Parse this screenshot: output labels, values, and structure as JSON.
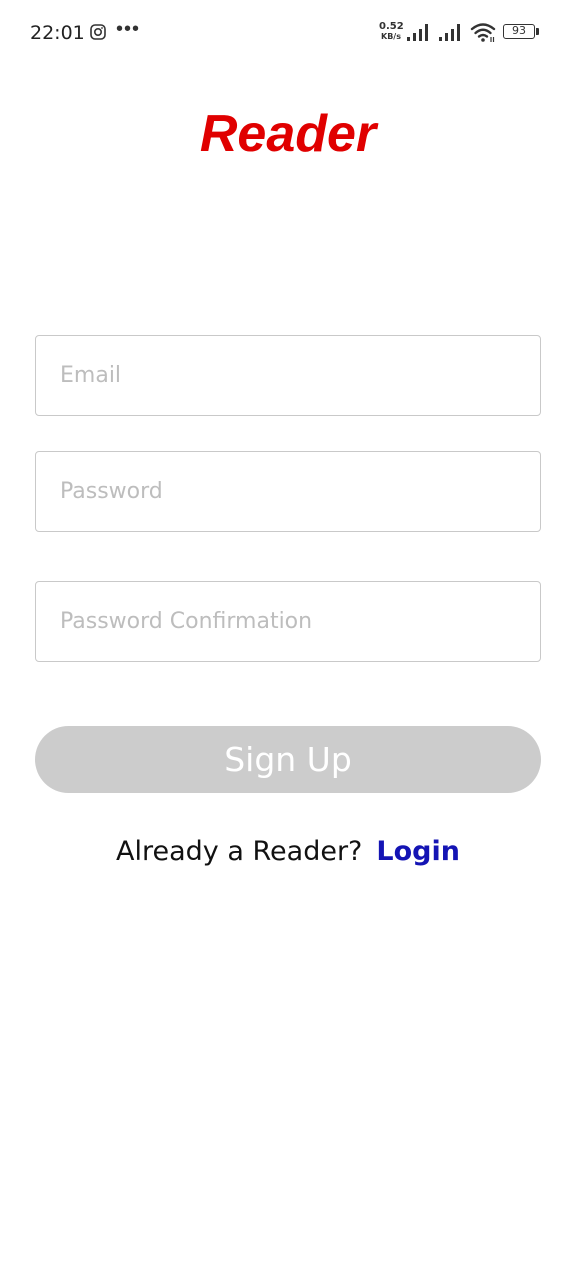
{
  "status_bar": {
    "time": "22:01",
    "net_speed_value": "0.52",
    "net_speed_unit": "KB/s",
    "battery_level": "93",
    "icons": [
      "instagram-icon",
      "more-dots-icon",
      "signal-icon",
      "signal-icon",
      "wifi-icon",
      "battery-icon"
    ]
  },
  "app": {
    "logo_text": "Reader",
    "logo_color": "#e00000"
  },
  "form": {
    "email_placeholder": "Email",
    "email_value": "",
    "password_placeholder": "Password",
    "password_value": "",
    "password_confirm_placeholder": "Password Confirmation",
    "password_confirm_value": "",
    "signup_label": "Sign Up",
    "signup_color": "#cccccc"
  },
  "footer": {
    "prompt_text": "Already a Reader?",
    "login_label": "Login",
    "login_color": "#1414b4"
  }
}
